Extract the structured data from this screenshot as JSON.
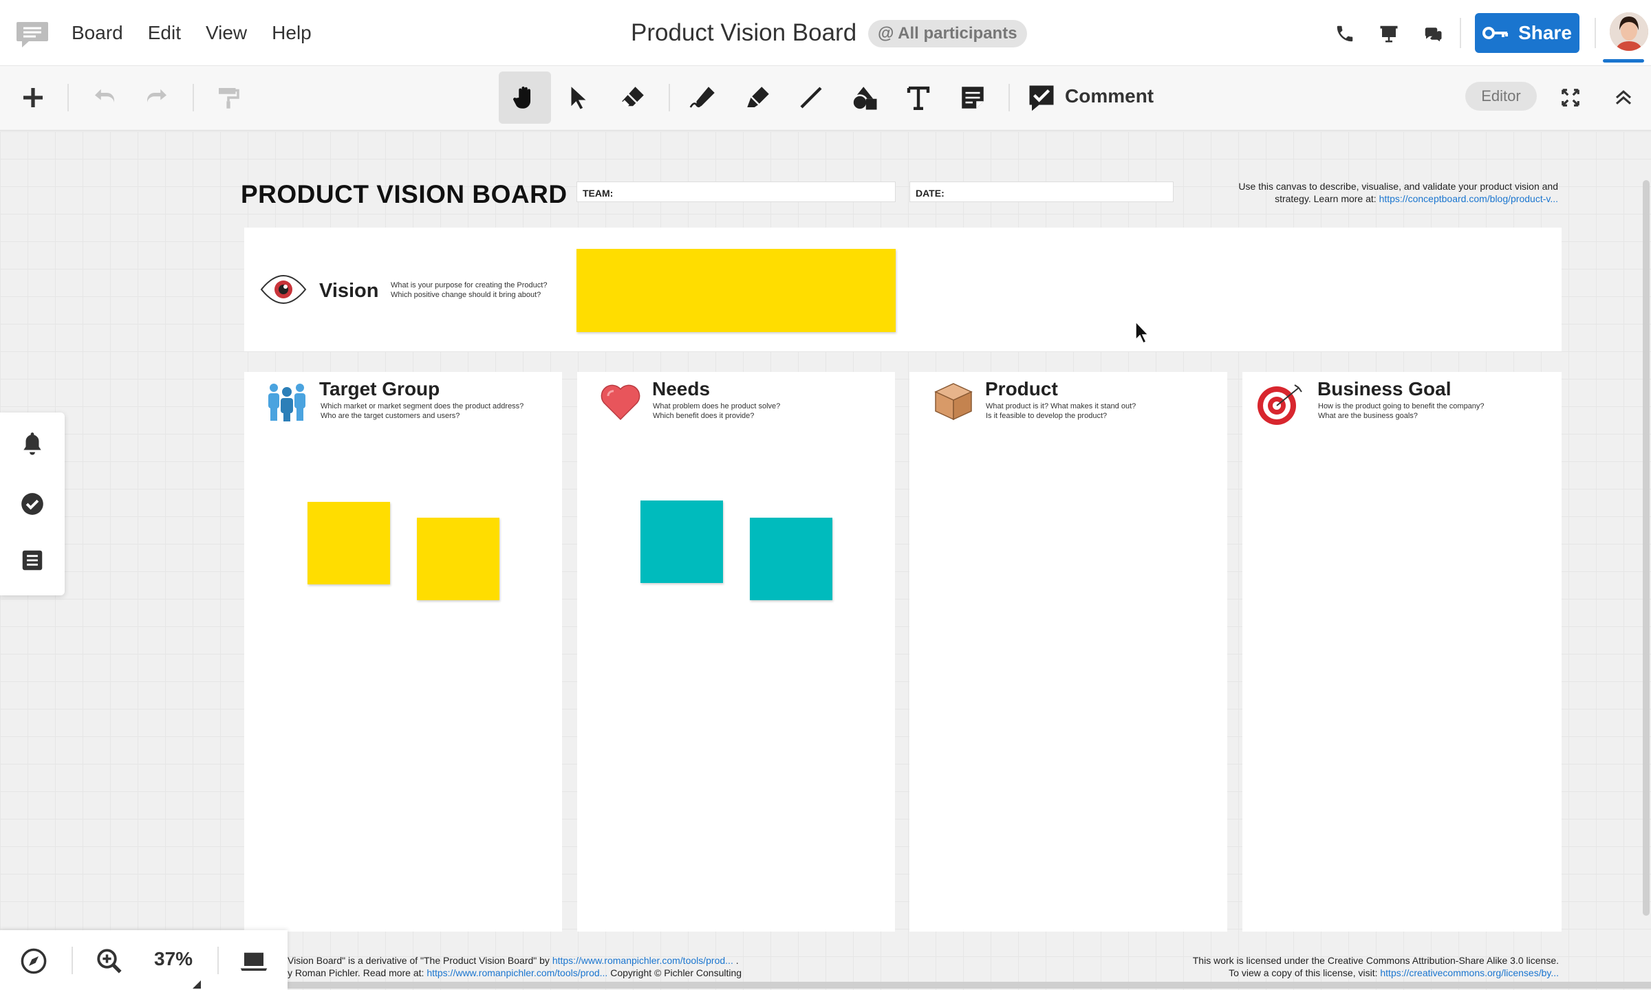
{
  "app": {
    "board_title": "Product Vision Board",
    "participants_badge": "@ All participants",
    "share_label": "Share",
    "menu": [
      "Board",
      "Edit",
      "View",
      "Help"
    ],
    "icons": {
      "logo": "conceptboard-logo-icon",
      "call": "phone-icon",
      "present": "presentation-icon",
      "chat": "chat-icon",
      "share": "key-icon"
    },
    "accent_color": "#1a75cf"
  },
  "toolbar": {
    "comment_label": "Comment",
    "editor_badge": "Editor",
    "active_tool": "hand",
    "tools": [
      "add",
      "undo",
      "redo",
      "format-painter",
      "hand",
      "select",
      "eraser",
      "pen",
      "highlighter",
      "line",
      "shapes",
      "text",
      "sticky-note",
      "comment",
      "fullscreen",
      "collapse"
    ]
  },
  "canvas": {
    "heading": "PRODUCT VISION BOARD",
    "team_label": "TEAM:",
    "date_label": "DATE:",
    "intro_line1": "Use this canvas to describe, visualise, and validate your product vision and",
    "intro_line2_text": "strategy. Learn more at: ",
    "intro_link": "https://conceptboard.com/blog/product-v...",
    "vision": {
      "title": "Vision",
      "desc1": "What is your purpose for creating the Product?",
      "desc2": "Which positive change should it bring about?"
    },
    "columns": [
      {
        "title": "Target Group",
        "desc1": "Which market or market segment does the product address?",
        "desc2": "Who are the target customers and users?",
        "icon": "people-icon"
      },
      {
        "title": "Needs",
        "desc1": "What problem does he product solve?",
        "desc2": "Which benefit does it provide?",
        "icon": "heart-icon"
      },
      {
        "title": "Product",
        "desc1": "What product is it? What makes it stand out?",
        "desc2": "Is it feasible to develop the product?",
        "icon": "box-icon"
      },
      {
        "title": "Business Goal",
        "desc1": "How is the product going to benefit the company?",
        "desc2": "What are the business goals?",
        "icon": "target-icon"
      }
    ],
    "sticky_colors": {
      "yellow": "#ffdd00",
      "teal": "#00bbbd"
    },
    "footer_left": {
      "line1_text": "Vision Board\" is a derivative of \"The Product Vision Board\" by ",
      "line1_link": "https://www.romanpichler.com/tools/prod...",
      "line1_end": " .",
      "line2_text": "y Roman Pichler. Read more at: ",
      "line2_link": "https://www.romanpichler.com/tools/prod...",
      "line2_end": " Copyright © Pichler Consulting"
    },
    "footer_right": {
      "line1": "This work is licensed under the Creative Commons Attribution-Share Alike 3.0 license.",
      "line2_text": "To view a copy of this license, visit: ",
      "line2_link": "https://creativecommons.org/licenses/by..."
    }
  },
  "side_panel": {
    "icons": [
      "bell-icon",
      "check-circle-icon",
      "list-icon"
    ]
  },
  "zoom": {
    "level": "37%"
  }
}
